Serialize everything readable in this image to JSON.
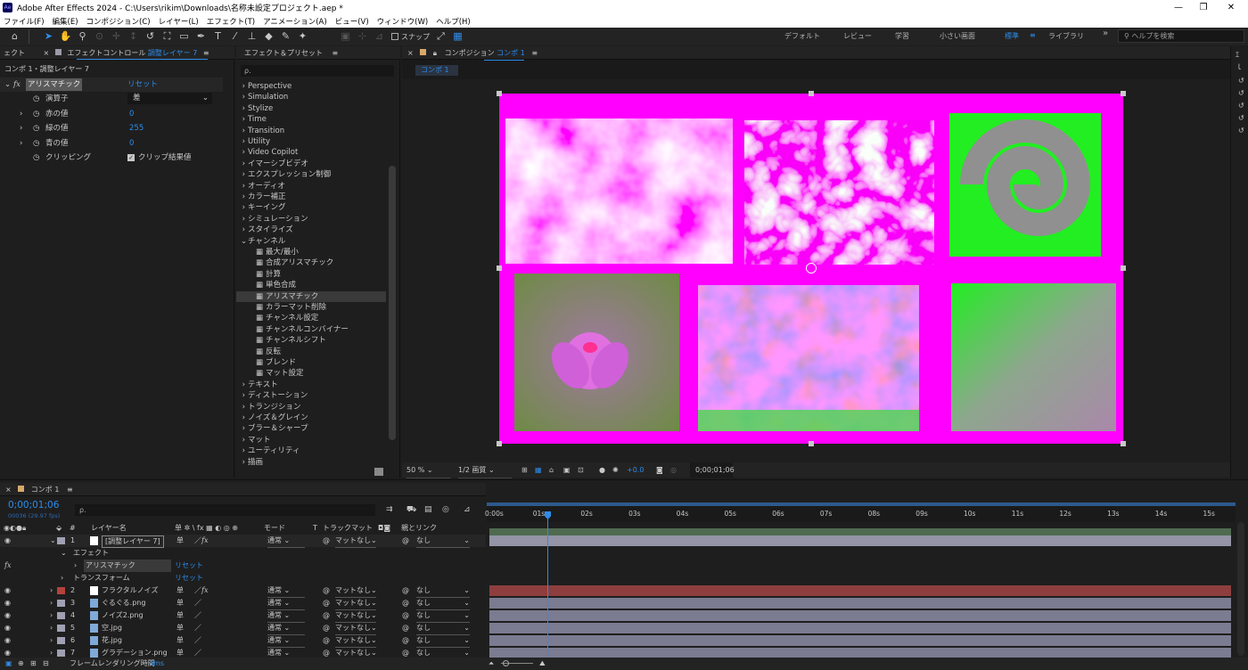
{
  "app": {
    "title": "Adobe After Effects 2024 - C:\\Users\\rikim\\Downloads\\名称未設定プロジェクト.aep *",
    "menu": [
      "ファイル(F)",
      "編集(E)",
      "コンポジション(C)",
      "レイヤー(L)",
      "エフェクト(T)",
      "アニメーション(A)",
      "ビュー(V)",
      "ウィンドウ(W)",
      "ヘルプ(H)"
    ]
  },
  "toolbar": {
    "snap_label": "スナップ",
    "workspaces": [
      "デフォルト",
      "レビュー",
      "学習",
      "小さい画面",
      "標準",
      "ライブラリ"
    ],
    "active_workspace": "標準",
    "help_placeholder": "ヘルプを検索"
  },
  "effect_controls": {
    "left_tab": "ェクト",
    "tab_prefix": "エフェクトコントロール",
    "tab_layer": "調整レイヤー 7",
    "breadcrumb": "コンポ 1・調整レイヤー 7",
    "effect_name": "アリスマチック",
    "reset_label": "リセット",
    "params": [
      {
        "label": "演算子",
        "value": "差"
      },
      {
        "label": "赤の値",
        "value": "0"
      },
      {
        "label": "緑の値",
        "value": "255"
      },
      {
        "label": "青の値",
        "value": "0"
      },
      {
        "label": "クリッピング",
        "value": "クリップ結果値"
      }
    ]
  },
  "effects_presets": {
    "tab": "エフェクト＆プリセット",
    "search_placeholder": "ρ.",
    "categories_top": [
      "Perspective",
      "Simulation",
      "Stylize",
      "Time",
      "Transition",
      "Utility",
      "Video Copilot",
      "イマーシブビデオ",
      "エクスプレッション制御",
      "オーディオ",
      "カラー補正",
      "キーイング",
      "シミュレーション",
      "スタイライズ"
    ],
    "open_category": "チャンネル",
    "channel_items": [
      "最大/最小",
      "合成アリスマチック",
      "計算",
      "単色合成",
      "アリスマチック",
      "カラーマット削除",
      "チャンネル設定",
      "チャンネルコンバイナー",
      "チャンネルシフト",
      "反転",
      "ブレンド",
      "マット設定"
    ],
    "selected_item": "アリスマチック",
    "categories_bottom": [
      "テキスト",
      "ディストーション",
      "トランジション",
      "ノイズ＆グレイン",
      "ブラー＆シャープ",
      "マット",
      "ユーティリティ",
      "描画"
    ]
  },
  "composition": {
    "tab_prefix": "コンポジション",
    "tab_name": "コンポ 1",
    "sub_tab": "コンポ 1",
    "zoom": "50 %",
    "resolution": "1/2 画質",
    "exposure": "+0.0",
    "timecode": "0;00;01;06",
    "colors": {
      "background": "#ff00ff",
      "green": "#22ee22",
      "gray": "#909090"
    }
  },
  "timeline": {
    "tab": "コンポ 1",
    "timecode": "0;00;01;06",
    "frame_info": "00036 (29.97 fps)",
    "search_placeholder": "ρ.",
    "columns": {
      "num": "#",
      "layer_name": "レイヤー名",
      "switches": "单 ✲ \\ fx ▦ ◐ ◎ ⊕",
      "mode": "モード",
      "t": "T",
      "trackmatte": "トラックマット",
      "parent": "親とリンク"
    },
    "ruler": [
      "0:00s",
      "01s",
      "02s",
      "03s",
      "04s",
      "05s",
      "06s",
      "07s",
      "08s",
      "09s",
      "10s",
      "11s",
      "12s",
      "13s",
      "14s",
      "15s"
    ],
    "playhead_seconds": 1.2,
    "layers": [
      {
        "num": "1",
        "name": "[調整レイヤー 7]",
        "label_color": "#a0a0b4",
        "mode": "通常",
        "trackmatte": "マットなし",
        "parent": "なし"
      },
      {
        "num": "2",
        "name": "フラクタルノイズ",
        "label_color": "#b4423c",
        "mode": "通常",
        "trackmatte": "マットなし",
        "parent": "なし"
      },
      {
        "num": "3",
        "name": "ぐるぐる.png",
        "label_color": "#a0a0b4",
        "mode": "通常",
        "trackmatte": "マットなし",
        "parent": "なし"
      },
      {
        "num": "4",
        "name": "ノイズ2.png",
        "label_color": "#a0a0b4",
        "mode": "通常",
        "trackmatte": "マットなし",
        "parent": "なし"
      },
      {
        "num": "5",
        "name": "空.jpg",
        "label_color": "#a0a0b4",
        "mode": "通常",
        "trackmatte": "マットなし",
        "parent": "なし"
      },
      {
        "num": "6",
        "name": "花.jpg",
        "label_color": "#a0a0b4",
        "mode": "通常",
        "trackmatte": "マットなし",
        "parent": "なし"
      },
      {
        "num": "7",
        "name": "グラデーション.png",
        "label_color": "#a0a0b4",
        "mode": "通常",
        "trackmatte": "マットなし",
        "parent": "なし"
      }
    ],
    "effects_group": "エフェクト",
    "effect_name": "アリスマチック",
    "transform": "トランスフォーム",
    "reset_label": "リセット",
    "footer_label": "フレームレンダリング時間",
    "footer_value": "4ms"
  }
}
